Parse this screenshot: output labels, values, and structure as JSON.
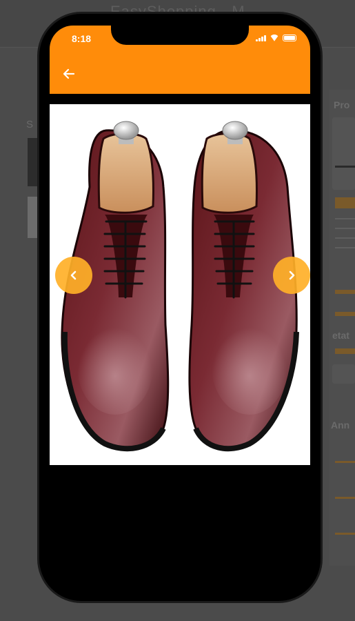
{
  "background": {
    "title": "EasyShopping - M",
    "left_fragment": "S",
    "right_fragments": [
      "Pro",
      "etat",
      "Ann"
    ]
  },
  "status_bar": {
    "time": "8:18",
    "icons": [
      "signal-icon",
      "wifi-icon",
      "battery-icon"
    ]
  },
  "app_bar": {
    "color": "#ff8c0a",
    "back_icon": "arrow-left-icon"
  },
  "gallery": {
    "image": "burgundy-oxford-shoes",
    "prev_icon": "chevron-left-icon",
    "next_icon": "chevron-right-icon",
    "nav_color": "#ffb028"
  }
}
